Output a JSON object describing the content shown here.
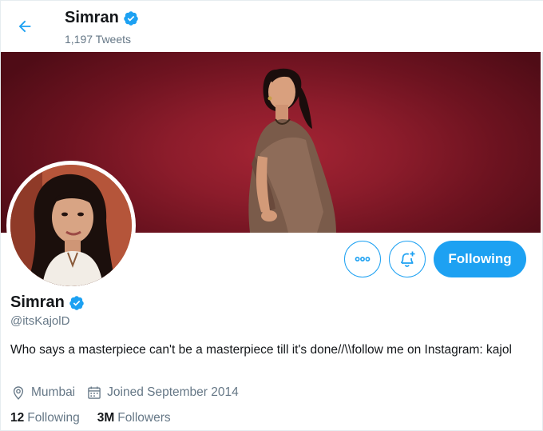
{
  "header": {
    "display_name": "Simran",
    "tweet_count": "1,197 Tweets"
  },
  "profile": {
    "display_name": "Simran",
    "handle": "@itsKajolD",
    "bio": "Who says a masterpiece can't be a masterpiece till it's done//\\\\follow me on Instagram: kajol",
    "location": "Mumbai",
    "joined": "Joined September 2014",
    "following_count": "12",
    "following_label": "Following",
    "followers_count": "3M",
    "followers_label": "Followers"
  },
  "actions": {
    "follow_state_label": "Following"
  },
  "icons": {
    "back": "arrow-left-icon",
    "verified": "verified-badge-icon",
    "more": "more-horizontal-icon",
    "notifications": "bell-plus-icon",
    "location": "location-pin-icon",
    "calendar": "calendar-icon"
  },
  "colors": {
    "accent": "#1da1f2",
    "text_primary": "#14171a",
    "text_secondary": "#657786",
    "banner_bg": "#8c1c2b"
  }
}
